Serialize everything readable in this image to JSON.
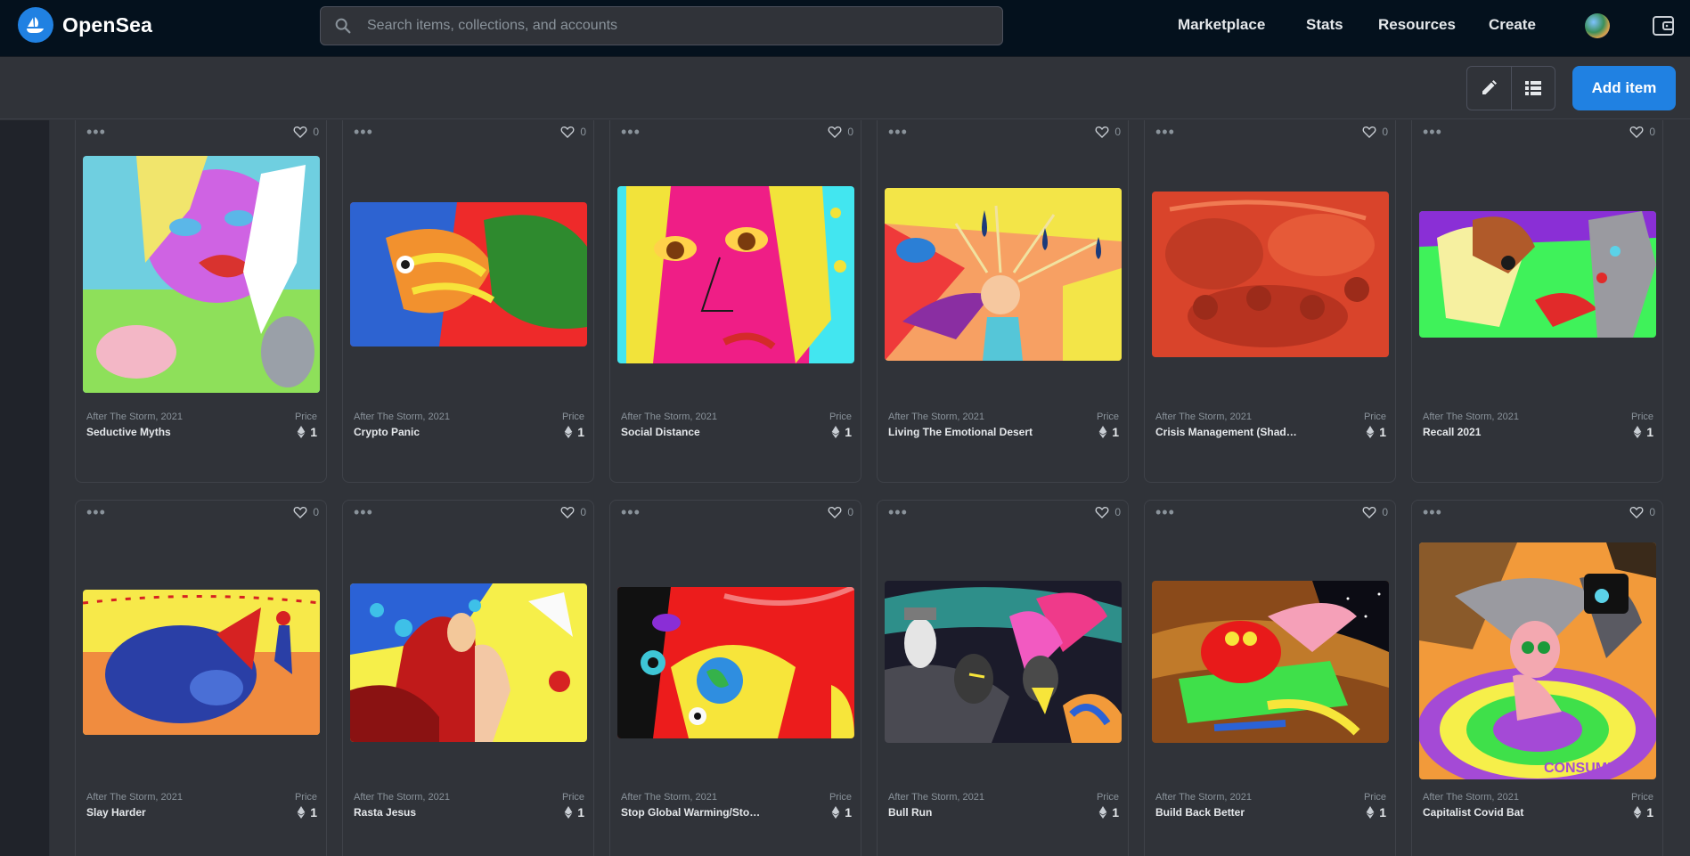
{
  "brand": {
    "name": "OpenSea"
  },
  "search": {
    "placeholder": "Search items, collections, and accounts"
  },
  "nav": {
    "marketplace": "Marketplace",
    "stats": "Stats",
    "resources": "Resources",
    "create": "Create"
  },
  "toolbar": {
    "add_item": "Add item"
  },
  "icons": {
    "search": "search-icon",
    "edit": "pencil-icon",
    "list": "list-icon",
    "wallet": "wallet-icon",
    "favorite": "heart-icon",
    "more": "more-dots-icon",
    "currency": "ethereum-icon"
  },
  "colors": {
    "brand_blue": "#2081e2",
    "nav_bg": "#04111d",
    "card_bg": "#303339"
  },
  "cards": [
    {
      "collection": "After The Storm, 2021",
      "name": "Seductive Myths",
      "price_label": "Price",
      "price": "1",
      "favorites": "0"
    },
    {
      "collection": "After The Storm, 2021",
      "name": "Crypto Panic",
      "price_label": "Price",
      "price": "1",
      "favorites": "0"
    },
    {
      "collection": "After The Storm, 2021",
      "name": "Social Distance",
      "price_label": "Price",
      "price": "1",
      "favorites": "0"
    },
    {
      "collection": "After The Storm, 2021",
      "name": "Living The Emotional Desert",
      "price_label": "Price",
      "price": "1",
      "favorites": "0"
    },
    {
      "collection": "After The Storm, 2021",
      "name": "Crisis Management (Shad…",
      "price_label": "Price",
      "price": "1",
      "favorites": "0"
    },
    {
      "collection": "After The Storm, 2021",
      "name": "Recall 2021",
      "price_label": "Price",
      "price": "1",
      "favorites": "0"
    },
    {
      "collection": "After The Storm, 2021",
      "name": "Slay Harder",
      "price_label": "Price",
      "price": "1",
      "favorites": "0"
    },
    {
      "collection": "After The Storm, 2021",
      "name": "Rasta Jesus",
      "price_label": "Price",
      "price": "1",
      "favorites": "0"
    },
    {
      "collection": "After The Storm, 2021",
      "name": "Stop Global Warming/Sto…",
      "price_label": "Price",
      "price": "1",
      "favorites": "0"
    },
    {
      "collection": "After The Storm, 2021",
      "name": "Bull Run",
      "price_label": "Price",
      "price": "1",
      "favorites": "0"
    },
    {
      "collection": "After The Storm, 2021",
      "name": "Build Back Better",
      "price_label": "Price",
      "price": "1",
      "favorites": "0"
    },
    {
      "collection": "After The Storm, 2021",
      "name": "Capitalist Covid Bat",
      "price_label": "Price",
      "price": "1",
      "favorites": "0"
    }
  ]
}
